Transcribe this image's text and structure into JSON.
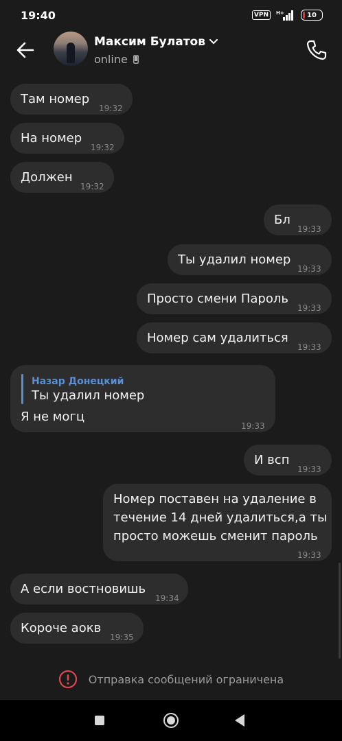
{
  "status_bar": {
    "time": "19:40",
    "vpn": "VPN",
    "network": "H+",
    "battery": "10"
  },
  "header": {
    "name": "Максим Булатов",
    "status": "online"
  },
  "messages": [
    {
      "text": "Там номер",
      "time": "19:32"
    },
    {
      "text": "На номер",
      "time": "19:32"
    },
    {
      "text": "Должен",
      "time": "19:32"
    },
    {
      "text": "Бл",
      "time": "19:33"
    },
    {
      "text": "Ты удалил номер",
      "time": "19:33"
    },
    {
      "text": "Просто смени Пароль",
      "time": "19:33"
    },
    {
      "text": "Номер сам удалиться",
      "time": "19:33"
    },
    {
      "reply_author": "Назар Донецкий",
      "reply_text": "Ты удалил номер",
      "text": "Я не могц",
      "time": "19:33"
    },
    {
      "text": "И всп",
      "time": "19:33"
    },
    {
      "lines": [
        "Номер поставен на удаление в",
        "течение 14 дней удалиться,а ты",
        "просто можешь сменит пароль"
      ],
      "time": "19:33"
    },
    {
      "text": "А если востновишь",
      "time": "19:34"
    },
    {
      "text": "Короче аокв",
      "time": "19:35"
    }
  ],
  "restriction": {
    "text": "Отправка сообщений ограничена"
  },
  "colors": {
    "background": "#1b1b1b",
    "bubble": "#2d2d2d",
    "reply_accent": "#5a8fd6",
    "warning": "#e0474c"
  }
}
